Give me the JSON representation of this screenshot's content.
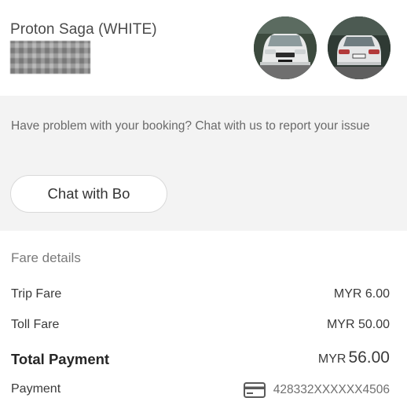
{
  "vehicle": {
    "name": "Proton Saga (WHITE)",
    "photo_front_icon": "car-front-photo",
    "photo_rear_icon": "car-rear-photo"
  },
  "help": {
    "text": "Have problem with your booking? Chat with us to report your issue",
    "chat_button_label": "Chat with Bo"
  },
  "fare": {
    "title": "Fare details",
    "trip_fare_label": "Trip Fare",
    "trip_fare_amount": "MYR 6.00",
    "toll_fare_label": "Toll Fare",
    "toll_fare_amount": "MYR 50.00",
    "total_label": "Total Payment",
    "total_currency": "MYR",
    "total_value": "56.00",
    "payment_label": "Payment",
    "payment_icon": "credit-card-icon",
    "card_number": "428332XXXXXX4506"
  },
  "colors": {
    "panel_background": "#f3f3f3",
    "text_primary": "#3a3a3a",
    "text_muted": "#6a6a6a"
  }
}
